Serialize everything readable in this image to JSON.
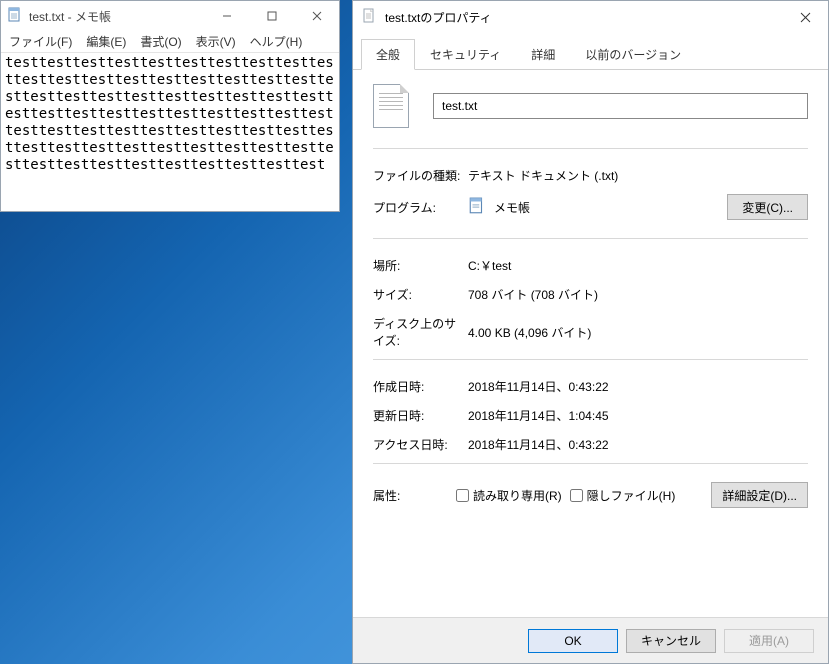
{
  "notepad": {
    "title": "test.txt - メモ帳",
    "menu": {
      "file": "ファイル(F)",
      "edit": "編集(E)",
      "format": "書式(O)",
      "view": "表示(V)",
      "help": "ヘルプ(H)"
    },
    "body": "testtesttesttesttesttesttesttesttesttesttesttesttesttesttesttesttesttesttesttesttesttesttesttesttesttesttesttesttesttesttesttesttesttesttesttesttesttesttesttesttesttesttesttesttesttesttesttesttesttesttesttesttesttesttesttesttesttesttesttesttesttesttesttesttesttesttesttest"
  },
  "properties": {
    "title": "test.txtのプロパティ",
    "tabs": {
      "general": "全般",
      "security": "セキュリティ",
      "details": "詳細",
      "previous": "以前のバージョン"
    },
    "filename": "test.txt",
    "labels": {
      "type": "ファイルの種類:",
      "program": "プログラム:",
      "location": "場所:",
      "size": "サイズ:",
      "disk": "ディスク上のサイズ:",
      "created": "作成日時:",
      "modified": "更新日時:",
      "accessed": "アクセス日時:",
      "attributes": "属性:",
      "readonly": "読み取り専用(R)",
      "hidden": "隠しファイル(H)"
    },
    "values": {
      "type": "テキスト ドキュメント (.txt)",
      "program": "メモ帳",
      "location": "C:￥test",
      "size": "708 バイト (708 バイト)",
      "disk": "4.00 KB (4,096 バイト)",
      "created": "2018年11月14日、0:43:22",
      "modified": "2018年11月14日、1:04:45",
      "accessed": "2018年11月14日、0:43:22"
    },
    "buttons": {
      "change": "変更(C)...",
      "advanced": "詳細設定(D)...",
      "ok": "OK",
      "cancel": "キャンセル",
      "apply": "適用(A)"
    }
  }
}
